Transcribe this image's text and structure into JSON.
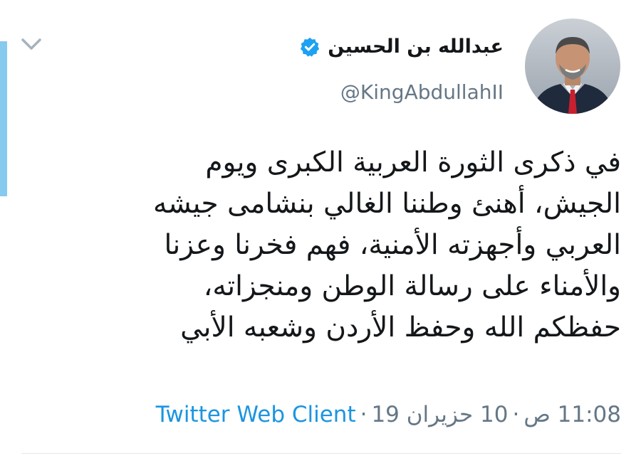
{
  "tweet": {
    "display_name": "عبدالله بن الحسين",
    "handle": "@KingAbdullahII",
    "verified_icon": "verified-badge-icon",
    "text_lines": [
      "في ذكرى الثورة العربية الكبرى ويوم",
      "الجيش، أهنئ وطننا الغالي بنشامى جيشه",
      "العربي وأجهزته الأمنية، فهم فخرنا وعزنا",
      "والأمناء على رسالة الوطن ومنجزاته،",
      "حفظكم الله وحفظ الأردن وشعبه الأبي"
    ],
    "time": "11:08 ص",
    "separator": "·",
    "date": "10 حزيران 19",
    "client": "Twitter Web Client"
  },
  "colors": {
    "accent": "#1da1f2",
    "client_link": "#1b95e0",
    "secondary_text": "#657786",
    "primary_text": "#14171a",
    "left_accent_bar": "#88c9ef"
  },
  "icons": {
    "menu": "chevron-down-icon",
    "avatar": "avatar"
  }
}
